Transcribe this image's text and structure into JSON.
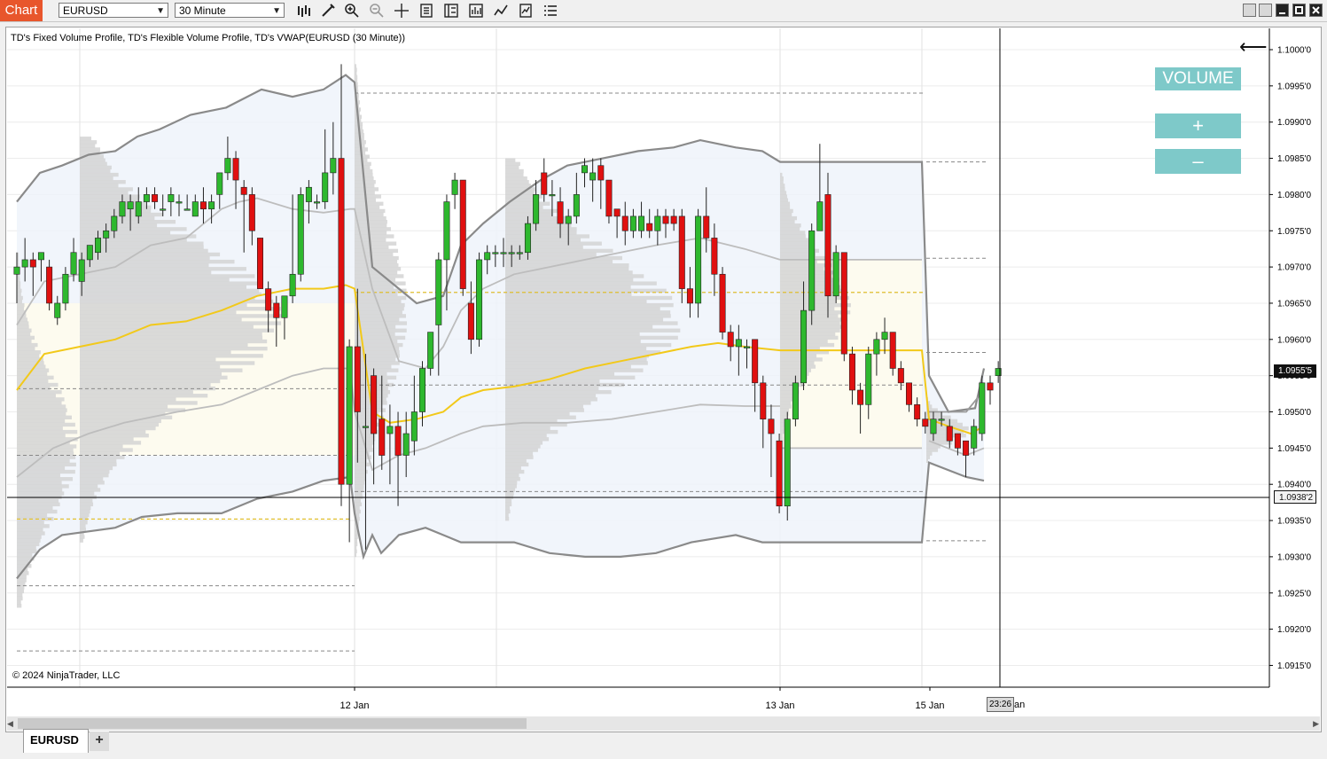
{
  "toolbar": {
    "tab_label": "Chart",
    "instrument": "EURUSD",
    "interval": "30 Minute",
    "tools": [
      "bar-type-icon",
      "draw-tools-icon",
      "zoom-in-icon",
      "zoom-out-icon",
      "crosshair-icon",
      "data-box-icon",
      "properties-icon",
      "indicators-icon",
      "strategies-icon",
      "templates-icon",
      "menu-icon"
    ]
  },
  "chart": {
    "title": "TD's Fixed Volume Profile, TD's Flexible Volume Profile, TD's VWAP(EURUSD (30 Minute))",
    "copyright": "© 2024 NinjaTrader, LLC",
    "last_price": "1.0955'5",
    "crosshair_price": "1.0938'2",
    "crosshair_time": "23:26",
    "crosshair_date_suffix": "an",
    "colors": {
      "up": "#2eb82e",
      "down": "#e01010",
      "vwap": "#f2c91a",
      "band": "#8a8a8a"
    }
  },
  "panel": {
    "volume_label": "VOLUME",
    "plus_label": "+",
    "minus_label": "–"
  },
  "tabs": {
    "symbol": "EURUSD",
    "add": "+"
  },
  "chart_data": {
    "type": "candlestick",
    "title": "TD's Fixed Volume Profile, TD's Flexible Volume Profile, TD's VWAP(EURUSD (30 Minute))",
    "y_ticks": [
      "1.1000'0",
      "1.0995'0",
      "1.0990'0",
      "1.0985'0",
      "1.0980'0",
      "1.0975'0",
      "1.0970'0",
      "1.0965'0",
      "1.0960'0",
      "1.0955'0",
      "1.0950'0",
      "1.0945'0",
      "1.0940'0",
      "1.0935'0",
      "1.0930'0",
      "1.0925'0",
      "1.0920'0",
      "1.0915'0"
    ],
    "x_ticks": [
      "12 Jan",
      "13 Jan",
      "15 Jan"
    ],
    "ylim": [
      1.0913,
      1.1002
    ],
    "candles": [
      {
        "o": 1.0969,
        "c": 1.097,
        "h": 1.0972,
        "l": 1.0965
      },
      {
        "o": 1.097,
        "c": 1.0971,
        "h": 1.0974,
        "l": 1.0968
      },
      {
        "o": 1.0971,
        "c": 1.097,
        "h": 1.0972,
        "l": 1.0966
      },
      {
        "o": 1.0971,
        "c": 1.0972,
        "h": 1.0972,
        "l": 1.0968
      },
      {
        "o": 1.097,
        "c": 1.0965,
        "h": 1.0971,
        "l": 1.0964
      },
      {
        "o": 1.0963,
        "c": 1.0965,
        "h": 1.0966,
        "l": 1.0962
      },
      {
        "o": 1.0965,
        "c": 1.0969,
        "h": 1.097,
        "l": 1.0964
      },
      {
        "o": 1.0969,
        "c": 1.0972,
        "h": 1.0974,
        "l": 1.0968
      },
      {
        "o": 1.0968,
        "c": 1.0971,
        "h": 1.0972,
        "l": 1.0966
      },
      {
        "o": 1.0971,
        "c": 1.0973,
        "h": 1.0973,
        "l": 1.097
      },
      {
        "o": 1.0972,
        "c": 1.0974,
        "h": 1.0975,
        "l": 1.0971
      },
      {
        "o": 1.0974,
        "c": 1.0975,
        "h": 1.0976,
        "l": 1.0972
      },
      {
        "o": 1.0975,
        "c": 1.0977,
        "h": 1.0978,
        "l": 1.0974
      },
      {
        "o": 1.0977,
        "c": 1.0979,
        "h": 1.098,
        "l": 1.0976
      },
      {
        "o": 1.0978,
        "c": 1.0979,
        "h": 1.098,
        "l": 1.0975
      },
      {
        "o": 1.0977,
        "c": 1.0979,
        "h": 1.0981,
        "l": 1.0976
      },
      {
        "o": 1.0979,
        "c": 1.098,
        "h": 1.0981,
        "l": 1.0978
      },
      {
        "o": 1.098,
        "c": 1.0979,
        "h": 1.0981,
        "l": 1.0978
      },
      {
        "o": 1.0978,
        "c": 1.0978,
        "h": 1.098,
        "l": 1.0977
      },
      {
        "o": 1.0979,
        "c": 1.098,
        "h": 1.0981,
        "l": 1.0977
      },
      {
        "o": 1.0979,
        "c": 1.0979,
        "h": 1.098,
        "l": 1.0977
      },
      {
        "o": 1.0978,
        "c": 1.0978,
        "h": 1.098,
        "l": 1.0978
      },
      {
        "o": 1.0977,
        "c": 1.0979,
        "h": 1.098,
        "l": 1.0977
      },
      {
        "o": 1.0979,
        "c": 1.0978,
        "h": 1.0981,
        "l": 1.0976
      },
      {
        "o": 1.0978,
        "c": 1.0979,
        "h": 1.098,
        "l": 1.0976
      },
      {
        "o": 1.098,
        "c": 1.0983,
        "h": 1.0983,
        "l": 1.0978
      },
      {
        "o": 1.0983,
        "c": 1.0985,
        "h": 1.0988,
        "l": 1.0982
      },
      {
        "o": 1.0985,
        "c": 1.0982,
        "h": 1.0986,
        "l": 1.0978
      },
      {
        "o": 1.0981,
        "c": 1.098,
        "h": 1.0982,
        "l": 1.0972
      },
      {
        "o": 1.098,
        "c": 1.0975,
        "h": 1.0981,
        "l": 1.0973
      },
      {
        "o": 1.0974,
        "c": 1.0967,
        "h": 1.0974,
        "l": 1.0967
      },
      {
        "o": 1.0967,
        "c": 1.0964,
        "h": 1.0968,
        "l": 1.0961
      },
      {
        "o": 1.0965,
        "c": 1.0963,
        "h": 1.0966,
        "l": 1.0959
      },
      {
        "o": 1.0963,
        "c": 1.0966,
        "h": 1.0966,
        "l": 1.096
      },
      {
        "o": 1.0966,
        "c": 1.0969,
        "h": 1.098,
        "l": 1.0965
      },
      {
        "o": 1.0969,
        "c": 1.098,
        "h": 1.0981,
        "l": 1.0968
      },
      {
        "o": 1.0979,
        "c": 1.0981,
        "h": 1.0982,
        "l": 1.0976
      },
      {
        "o": 1.0979,
        "c": 1.0979,
        "h": 1.098,
        "l": 1.0978
      },
      {
        "o": 1.0979,
        "c": 1.0983,
        "h": 1.0989,
        "l": 1.0978
      },
      {
        "o": 1.0983,
        "c": 1.0985,
        "h": 1.099,
        "l": 1.098
      },
      {
        "o": 1.0985,
        "c": 1.094,
        "h": 1.0998,
        "l": 1.0937
      },
      {
        "o": 1.094,
        "c": 1.0959,
        "h": 1.096,
        "l": 1.0932
      },
      {
        "o": 1.0959,
        "c": 1.095,
        "h": 1.0967,
        "l": 1.0943
      },
      {
        "o": 1.0948,
        "c": 1.0948,
        "h": 1.0958,
        "l": 1.0931
      },
      {
        "o": 1.0955,
        "c": 1.0947,
        "h": 1.0956,
        "l": 1.094
      },
      {
        "o": 1.0949,
        "c": 1.0944,
        "h": 1.0955,
        "l": 1.0942
      },
      {
        "o": 1.0947,
        "c": 1.0948,
        "h": 1.0951,
        "l": 1.094
      },
      {
        "o": 1.0948,
        "c": 1.0944,
        "h": 1.095,
        "l": 1.0937
      },
      {
        "o": 1.0944,
        "c": 1.0947,
        "h": 1.095,
        "l": 1.0941
      },
      {
        "o": 1.0946,
        "c": 1.095,
        "h": 1.0955,
        "l": 1.0944
      },
      {
        "o": 1.095,
        "c": 1.0956,
        "h": 1.0957,
        "l": 1.0948
      },
      {
        "o": 1.0956,
        "c": 1.0961,
        "h": 1.0961,
        "l": 1.0955
      },
      {
        "o": 1.0962,
        "c": 1.0971,
        "h": 1.0972,
        "l": 1.0955
      },
      {
        "o": 1.0971,
        "c": 1.0979,
        "h": 1.098,
        "l": 1.0964
      },
      {
        "o": 1.098,
        "c": 1.0982,
        "h": 1.0983,
        "l": 1.0978
      },
      {
        "o": 1.0982,
        "c": 1.0967,
        "h": 1.0982,
        "l": 1.0966
      },
      {
        "o": 1.0965,
        "c": 1.096,
        "h": 1.0968,
        "l": 1.0958
      },
      {
        "o": 1.096,
        "c": 1.0971,
        "h": 1.0972,
        "l": 1.0959
      },
      {
        "o": 1.0971,
        "c": 1.0972,
        "h": 1.0973,
        "l": 1.0969
      },
      {
        "o": 1.0972,
        "c": 1.0972,
        "h": 1.0973,
        "l": 1.097
      },
      {
        "o": 1.0972,
        "c": 1.0972,
        "h": 1.0974,
        "l": 1.097
      },
      {
        "o": 1.0972,
        "c": 1.0972,
        "h": 1.0973,
        "l": 1.097
      },
      {
        "o": 1.0972,
        "c": 1.0972,
        "h": 1.0973,
        "l": 1.0971
      },
      {
        "o": 1.0972,
        "c": 1.0976,
        "h": 1.0977,
        "l": 1.0971
      },
      {
        "o": 1.0976,
        "c": 1.098,
        "h": 1.0982,
        "l": 1.0975
      },
      {
        "o": 1.0983,
        "c": 1.098,
        "h": 1.0985,
        "l": 1.0979
      },
      {
        "o": 1.098,
        "c": 1.098,
        "h": 1.0982,
        "l": 1.0977
      },
      {
        "o": 1.0979,
        "c": 1.0976,
        "h": 1.0981,
        "l": 1.0974
      },
      {
        "o": 1.0976,
        "c": 1.0977,
        "h": 1.0978,
        "l": 1.0973
      },
      {
        "o": 1.0977,
        "c": 1.098,
        "h": 1.0983,
        "l": 1.0976
      },
      {
        "o": 1.0983,
        "c": 1.0984,
        "h": 1.0985,
        "l": 1.0981
      },
      {
        "o": 1.0982,
        "c": 1.0983,
        "h": 1.0985,
        "l": 1.0979
      },
      {
        "o": 1.0984,
        "c": 1.0982,
        "h": 1.0985,
        "l": 1.0978
      },
      {
        "o": 1.0982,
        "c": 1.0977,
        "h": 1.0982,
        "l": 1.0976
      },
      {
        "o": 1.0978,
        "c": 1.0977,
        "h": 1.0978,
        "l": 1.0974
      },
      {
        "o": 1.0977,
        "c": 1.0975,
        "h": 1.0979,
        "l": 1.0973
      },
      {
        "o": 1.0975,
        "c": 1.0977,
        "h": 1.0978,
        "l": 1.0974
      },
      {
        "o": 1.0975,
        "c": 1.0977,
        "h": 1.0979,
        "l": 1.0974
      },
      {
        "o": 1.0976,
        "c": 1.0975,
        "h": 1.0978,
        "l": 1.0974
      },
      {
        "o": 1.0975,
        "c": 1.0977,
        "h": 1.0978,
        "l": 1.0973
      },
      {
        "o": 1.0977,
        "c": 1.0976,
        "h": 1.0978,
        "l": 1.0974
      },
      {
        "o": 1.0977,
        "c": 1.0976,
        "h": 1.0978,
        "l": 1.0975
      },
      {
        "o": 1.0977,
        "c": 1.0967,
        "h": 1.0978,
        "l": 1.0965
      },
      {
        "o": 1.0967,
        "c": 1.0965,
        "h": 1.097,
        "l": 1.0963
      },
      {
        "o": 1.0965,
        "c": 1.0977,
        "h": 1.0978,
        "l": 1.0963
      },
      {
        "o": 1.0977,
        "c": 1.0974,
        "h": 1.0981,
        "l": 1.0972
      },
      {
        "o": 1.0974,
        "c": 1.0969,
        "h": 1.0976,
        "l": 1.0966
      },
      {
        "o": 1.0969,
        "c": 1.0961,
        "h": 1.097,
        "l": 1.096
      },
      {
        "o": 1.0961,
        "c": 1.0959,
        "h": 1.0962,
        "l": 1.0957
      },
      {
        "o": 1.0959,
        "c": 1.096,
        "h": 1.0962,
        "l": 1.0955
      },
      {
        "o": 1.0959,
        "c": 1.0959,
        "h": 1.096,
        "l": 1.0956
      },
      {
        "o": 1.096,
        "c": 1.0954,
        "h": 1.096,
        "l": 1.095
      },
      {
        "o": 1.0954,
        "c": 1.0949,
        "h": 1.0955,
        "l": 1.0945
      },
      {
        "o": 1.0949,
        "c": 1.0947,
        "h": 1.0951,
        "l": 1.0941
      },
      {
        "o": 1.0946,
        "c": 1.0937,
        "h": 1.0947,
        "l": 1.0936
      },
      {
        "o": 1.0937,
        "c": 1.0949,
        "h": 1.095,
        "l": 1.0935
      },
      {
        "o": 1.0949,
        "c": 1.0954,
        "h": 1.0955,
        "l": 1.0948
      },
      {
        "o": 1.0954,
        "c": 1.0964,
        "h": 1.0968,
        "l": 1.0953
      },
      {
        "o": 1.0964,
        "c": 1.0975,
        "h": 1.0976,
        "l": 1.0962
      },
      {
        "o": 1.0975,
        "c": 1.0979,
        "h": 1.0987,
        "l": 1.0975
      },
      {
        "o": 1.098,
        "c": 1.0966,
        "h": 1.0983,
        "l": 1.0963
      },
      {
        "o": 1.0966,
        "c": 1.0972,
        "h": 1.0973,
        "l": 1.0965
      },
      {
        "o": 1.0972,
        "c": 1.0958,
        "h": 1.0972,
        "l": 1.0957
      },
      {
        "o": 1.0958,
        "c": 1.0953,
        "h": 1.0959,
        "l": 1.0951
      },
      {
        "o": 1.0953,
        "c": 1.0951,
        "h": 1.0954,
        "l": 1.0947
      },
      {
        "o": 1.0951,
        "c": 1.0958,
        "h": 1.0959,
        "l": 1.0949
      },
      {
        "o": 1.0958,
        "c": 1.096,
        "h": 1.0961,
        "l": 1.0955
      },
      {
        "o": 1.096,
        "c": 1.0961,
        "h": 1.0963,
        "l": 1.0958
      },
      {
        "o": 1.0961,
        "c": 1.0956,
        "h": 1.0961,
        "l": 1.0955
      },
      {
        "o": 1.0956,
        "c": 1.0954,
        "h": 1.0957,
        "l": 1.0953
      },
      {
        "o": 1.0954,
        "c": 1.0951,
        "h": 1.0954,
        "l": 1.095
      },
      {
        "o": 1.0951,
        "c": 1.0949,
        "h": 1.0952,
        "l": 1.0948
      },
      {
        "o": 1.0949,
        "c": 1.0948,
        "h": 1.095,
        "l": 1.0947
      },
      {
        "o": 1.0947,
        "c": 1.0949,
        "h": 1.095,
        "l": 1.0946
      },
      {
        "o": 1.0949,
        "c": 1.0949,
        "h": 1.095,
        "l": 1.0948
      },
      {
        "o": 1.0948,
        "c": 1.0946,
        "h": 1.0949,
        "l": 1.0945
      },
      {
        "o": 1.0947,
        "c": 1.0945,
        "h": 1.0947,
        "l": 1.0944
      },
      {
        "o": 1.0946,
        "c": 1.0944,
        "h": 1.0946,
        "l": 1.0941
      },
      {
        "o": 1.0945,
        "c": 1.0948,
        "h": 1.0949,
        "l": 1.0944
      },
      {
        "o": 1.0947,
        "c": 1.0954,
        "h": 1.0955,
        "l": 1.0946
      },
      {
        "o": 1.0954,
        "c": 1.0953,
        "h": 1.0955,
        "l": 1.0951
      },
      {
        "o": 1.0955,
        "c": 1.0956,
        "h": 1.0957,
        "l": 1.0954
      }
    ]
  }
}
